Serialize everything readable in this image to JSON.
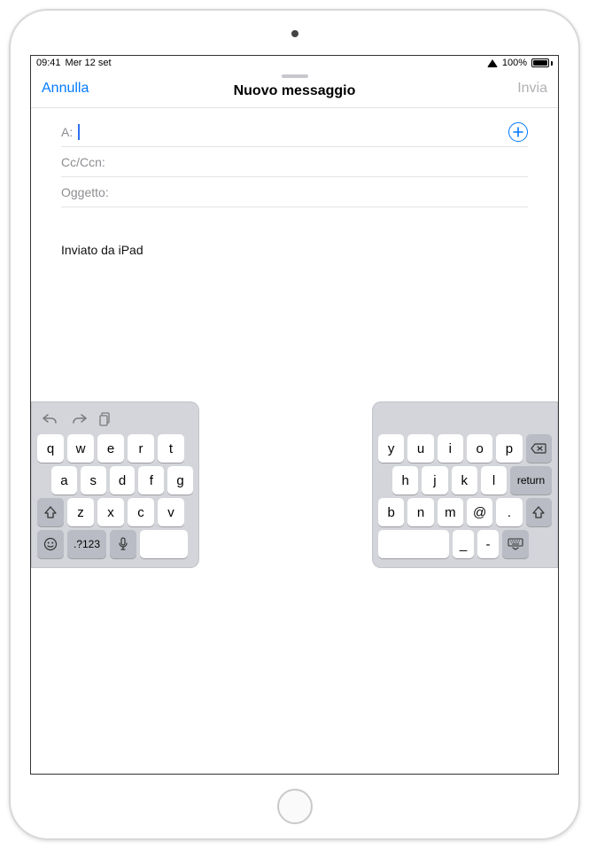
{
  "status": {
    "time": "09:41",
    "date": "Mer 12 set",
    "battery_pct": "100%"
  },
  "header": {
    "cancel": "Annulla",
    "title": "Nuovo messaggio",
    "send": "Invia"
  },
  "fields": {
    "to_label": "A:",
    "to_value": "",
    "cc_label": "Cc/Ccn:",
    "subject_label": "Oggetto:"
  },
  "body": {
    "signature": "Inviato da iPad"
  },
  "keyboard": {
    "left": {
      "row1": [
        "q",
        "w",
        "e",
        "r",
        "t"
      ],
      "row2": [
        "a",
        "s",
        "d",
        "f",
        "g"
      ],
      "row3": [
        "z",
        "x",
        "c",
        "v"
      ],
      "sym_label": ".?123"
    },
    "right": {
      "row1": [
        "y",
        "u",
        "i",
        "o",
        "p"
      ],
      "row2": [
        "h",
        "j",
        "k",
        "l"
      ],
      "row3": [
        "b",
        "n",
        "m",
        "@",
        "."
      ],
      "return_label": "return",
      "underscore": "_",
      "hyphen": "-"
    }
  }
}
